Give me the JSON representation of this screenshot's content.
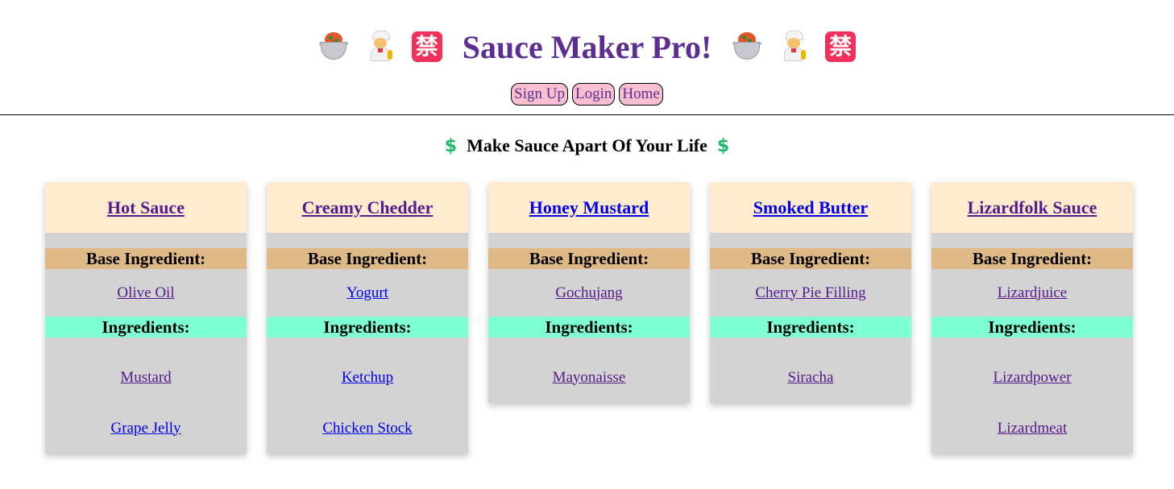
{
  "header": {
    "title": "Sauce Maker Pro!",
    "icons": [
      "pot-of-food-icon",
      "cook-icon",
      "prohibited-kanji-icon"
    ],
    "nav": [
      "Sign Up",
      "Login",
      "Home"
    ]
  },
  "tagline": {
    "text": "Make Sauce Apart Of Your Life",
    "icon_glyph": "$"
  },
  "labels": {
    "base": "Base Ingredient:",
    "ingredients": "Ingredients:"
  },
  "colors": {
    "title": "#5b2e91",
    "nav_bg": "#f7bfd0",
    "card_head_bg": "#ffebcd",
    "card_bg": "#d3d3d3",
    "base_head_bg": "#deb887",
    "ing_head_bg": "#7fffd4",
    "dollar": "#1fb86a",
    "visited_link": "#551a8b",
    "link": "#0000ee"
  },
  "cards": [
    {
      "title": "Hot Sauce",
      "base": "Olive Oil",
      "ingredients": [
        "Mustard",
        "Grape Jelly"
      ]
    },
    {
      "title": "Creamy Chedder",
      "base": "Yogurt",
      "ingredients": [
        "Ketchup",
        "Chicken Stock"
      ]
    },
    {
      "title": "Honey Mustard",
      "base": "Gochujang",
      "ingredients": [
        "Mayonaisse"
      ]
    },
    {
      "title": "Smoked Butter",
      "base": "Cherry Pie Filling",
      "ingredients": [
        "Siracha"
      ]
    },
    {
      "title": "Lizardfolk Sauce",
      "base": "Lizardjuice",
      "ingredients": [
        "Lizardpower",
        "Lizardmeat"
      ]
    }
  ]
}
